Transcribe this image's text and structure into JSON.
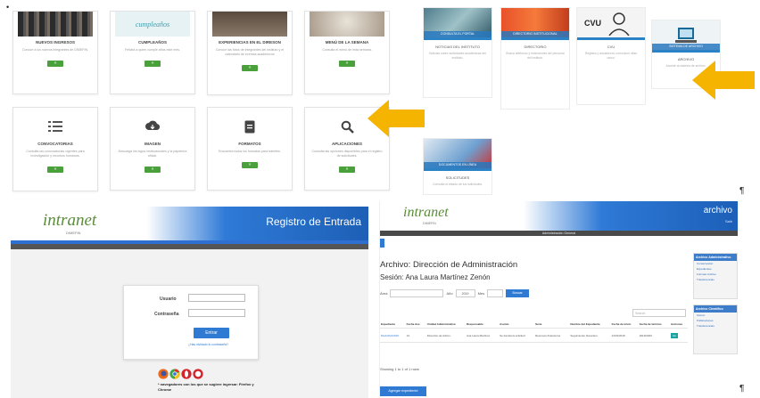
{
  "colors": {
    "green": "#4aa03a",
    "blue": "#2f7bd4",
    "arrow": "#f5b400",
    "logo_green": "#5a8c3a"
  },
  "top_left_cards": [
    {
      "title": "NUEVOS INGRESOS",
      "desc": "Conoce a los nuevos integrantes de DIMEFIN.",
      "btn": "»",
      "thumb": "#3b3b3b"
    },
    {
      "title": "CUMPLEAÑOS",
      "desc": "Felicita a quien cumple años este mes.",
      "btn": "»",
      "thumb": "#e8f3f5"
    },
    {
      "title": "EXPERIENCIAS EN EL DIRESON",
      "desc": "Conoce las fotos de integrantes del instituto y el calendario de eventos académicos",
      "btn": "»",
      "thumb": "#6b5b4e"
    },
    {
      "title": "MENÚ DE LA SEMANA",
      "desc": "Consulta el menú de esta semana.",
      "btn": "»",
      "thumb": "#c9c2b8"
    },
    {
      "title": "CONVOCATORIAS",
      "desc": "Consulta las convocatorias vigentes para investigación y recursos humanos.",
      "btn": "»",
      "icon": "list-icon"
    },
    {
      "title": "IMAGEN",
      "desc": "Descarga los logos institucionales y la papelería oficial.",
      "btn": "»",
      "icon": "cloud-download-icon"
    },
    {
      "title": "FORMATOS",
      "desc": "Encuentra todos los formatos para trámites.",
      "btn": "»",
      "icon": "document-icon"
    },
    {
      "title": "APLICACIONES",
      "desc": "Consulta las opciones disponibles para el registro de solicitudes.",
      "btn": "»",
      "icon": "search-icon"
    }
  ],
  "top_right_cards": [
    {
      "banner": "CONSULTA EL PORTAL",
      "title": "NOTICIAS DEL INSTITUTO",
      "desc": "Noticias sobre actividades académicas del instituto."
    },
    {
      "banner": "DIRECTORIO INSTITUCIONAL",
      "title": "DIRECTORIO",
      "desc": "Busca teléfonos y extensiones del personal del instituto."
    },
    {
      "banner": "",
      "title": "CVU",
      "desc": "Registra y actualiza tu currículum vitae único."
    },
    {
      "banner": "SISTEMA DE ARCHIVO",
      "title": "ARCHIVO",
      "desc": "Accede al sistema de archivo."
    },
    {
      "banner": "DOCUMENTOS EN LÍNEA",
      "title": "SOLICITUDES",
      "desc": "Consulta el estado de tus solicitudes."
    }
  ],
  "login": {
    "logo": "intranet",
    "logo_sub": "DIMEFIN",
    "title": "Registro de Entrada",
    "user_label": "Usuario",
    "pass_label": "Contraseña",
    "submit": "Entrar",
    "forgot": "¿Has olvidado tu contraseña?",
    "browser_note": "* navegadores con los que se sugiere ingresar: Firefox y Chrome"
  },
  "archive": {
    "logo": "intranet",
    "logo_sub": "DIMEFIN",
    "app_title": "archivo",
    "app_sub": "Salir",
    "nav": "Administración   General",
    "heading": "Archivo: Dirección de Administración",
    "session": "Sesión: Ana Laura Martínez Zenón",
    "filter_area": "Área",
    "filter_year": "Año",
    "year_value": "2019",
    "filter_month": "Mes",
    "filter_btn": "Buscar",
    "search_placeholder": "Search",
    "columns": [
      "Expediente",
      "Fecha doc.",
      "Unidad Administrativa",
      "Responsable",
      "Asunto",
      "Serie",
      "Nombre del Expediente",
      "Fecha de inicio",
      "Fecha de término",
      "Acciones"
    ],
    "row": [
      "DGA/210/2019",
      "13",
      "Dirección de Admin.",
      "Ana Laura Martínez",
      "Se tramita la solicitud",
      "Recursos financieros",
      "Seguimiento financiero",
      "24/01/2019",
      "2019/2020",
      "Ver"
    ],
    "showing": "Showing 1 to 1 of 1 rows",
    "add_btn": "Agregar expediente",
    "side_admin_title": "Archivo Administrativo",
    "side_admin_items": [
      "Conservación",
      "Expedientes",
      "Formato Archivo",
      "Transferencias"
    ],
    "side_tech_title": "Archivo Científico",
    "side_tech_items": [
      "Acervo",
      "Publicaciones",
      "Transferencias"
    ]
  },
  "marks": {
    "pilcrow": "¶",
    "bullet": "•"
  }
}
